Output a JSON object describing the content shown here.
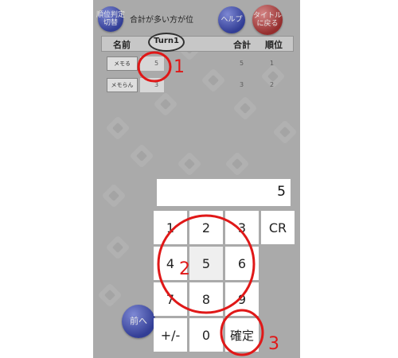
{
  "header": {
    "switch_button": "順位判定\n切替",
    "mode_label": "合計が多い方が位",
    "help_button": "ヘルプ",
    "back_button": "タイトル\nに戻る"
  },
  "table": {
    "col_name": "名前",
    "turn": "Turn1",
    "col_total": "合計",
    "col_rank": "順位",
    "rows": [
      {
        "name": "メモる",
        "score": "5",
        "total": "5",
        "rank": "1"
      },
      {
        "name": "メモらん",
        "score": "3",
        "total": "3",
        "rank": "2"
      }
    ]
  },
  "prev_button": "前へ",
  "keypad": {
    "display_value": "5",
    "keys": [
      "1",
      "2",
      "3",
      "CR",
      "4",
      "5",
      "6",
      "7",
      "8",
      "9",
      "+/-",
      "0",
      "確定"
    ]
  },
  "annotations": {
    "colors": {
      "marker": "#e01818"
    },
    "labels": [
      "1",
      "2",
      "3"
    ]
  }
}
